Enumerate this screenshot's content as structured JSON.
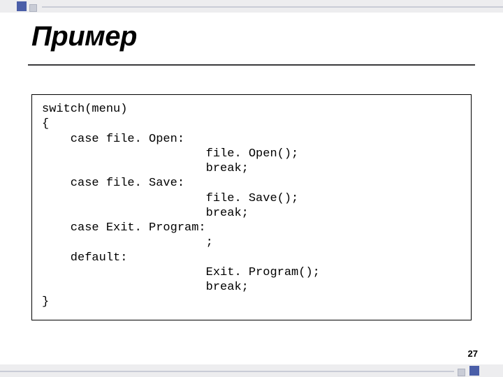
{
  "title": "Пример",
  "code": {
    "l01": "switch(menu)",
    "l02": "{",
    "l03": "    case file. Open:",
    "l04": "                       file. Open();",
    "l05": "                       break;",
    "l06": "    case file. Save:",
    "l07": "                       file. Save();",
    "l08": "                       break;",
    "l09": "    case Exit. Program:",
    "l10": "                       ;",
    "l11": "    default:",
    "l12": "                       Exit. Program();",
    "l13": "                       break;",
    "l14": "}"
  },
  "page_number": "27"
}
